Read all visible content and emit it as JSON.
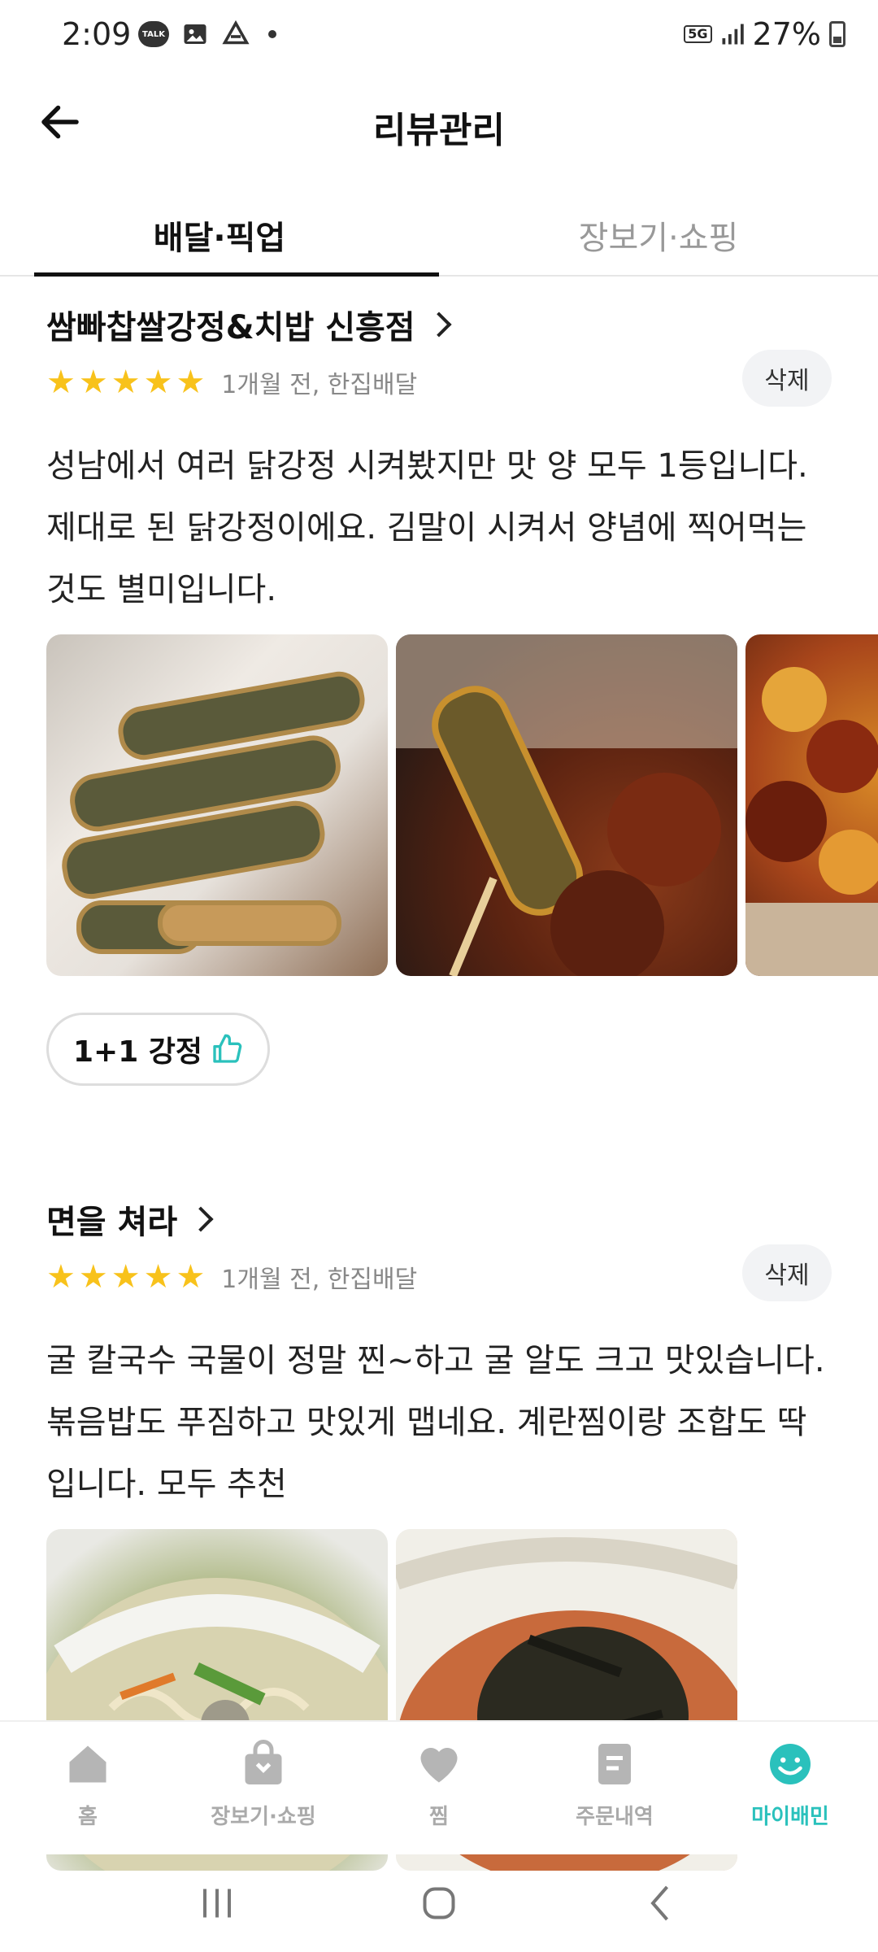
{
  "status_bar": {
    "time": "2:09",
    "talk_label": "TALK",
    "network": "5G",
    "battery": "27%"
  },
  "header": {
    "title": "리뷰관리"
  },
  "tabs": [
    {
      "label": "배달·픽업",
      "active": true
    },
    {
      "label": "장보기·쇼핑",
      "active": false
    }
  ],
  "reviews": [
    {
      "store": "쌈빠찹쌀강정&치밥 신흥점",
      "rating": 5,
      "meta": "1개월 전, 한집배달",
      "delete_label": "삭제",
      "text": "성남에서 여러 닭강정 시켜봤지만 맛 양 모두 1등입니다. 제대로 된 닭강정이에요. 김말이 시켜서 양념에 찍어먹는 것도 별미입니다.",
      "menu_chip": "1+1 강정"
    },
    {
      "store": "면을 쳐라",
      "rating": 5,
      "meta": "1개월 전, 한집배달",
      "delete_label": "삭제",
      "text": "굴 칼국수 국물이 정말 찐~하고 굴 알도 크고 맛있습니다. 볶음밥도 푸짐하고 맛있게 맵네요. 계란찜이랑 조합도 딱입니다. 모두 추천"
    }
  ],
  "bottom_nav": [
    {
      "label": "홈",
      "icon": "home-icon",
      "active": false
    },
    {
      "label": "장보기·쇼핑",
      "icon": "shopping-bag-icon",
      "active": false
    },
    {
      "label": "찜",
      "icon": "heart-icon",
      "active": false
    },
    {
      "label": "주문내역",
      "icon": "receipt-icon",
      "active": false
    },
    {
      "label": "마이배민",
      "icon": "smile-icon",
      "active": true
    }
  ],
  "colors": {
    "accent": "#2ac1bc",
    "star": "#f8c21b"
  }
}
